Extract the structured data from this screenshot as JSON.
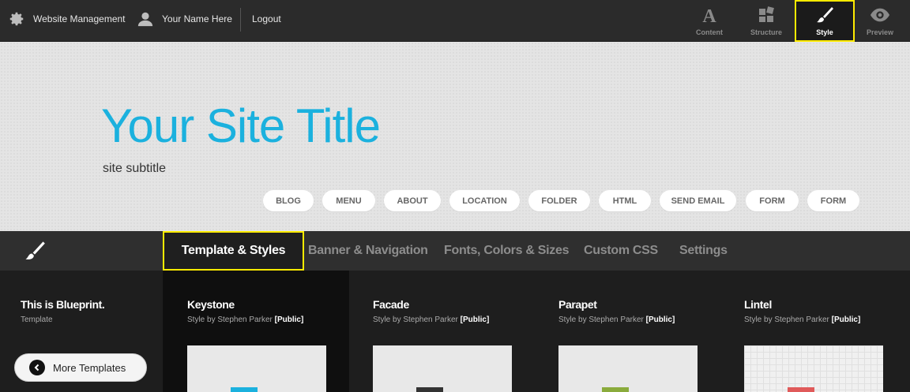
{
  "topbar": {
    "website_management": "Website Management",
    "user_name": "Your Name Here",
    "logout": "Logout",
    "tools": [
      {
        "label": "Content",
        "icon": "text-a-icon"
      },
      {
        "label": "Structure",
        "icon": "blocks-icon"
      },
      {
        "label": "Style",
        "icon": "brush-icon",
        "active": true
      },
      {
        "label": "Preview",
        "icon": "eye-icon"
      }
    ]
  },
  "banner": {
    "site_title": "Your Site Title",
    "site_subtitle": "site subtitle",
    "nav_items": [
      "BLOG",
      "MENU",
      "ABOUT",
      "LOCATION",
      "FOLDER",
      "HTML",
      "SEND EMAIL",
      "FORM",
      "FORM"
    ]
  },
  "tabs": [
    {
      "label": "Template & Styles",
      "active": true
    },
    {
      "label": "Banner & Navigation"
    },
    {
      "label": "Fonts, Colors & Sizes"
    },
    {
      "label": "Custom CSS"
    },
    {
      "label": "Settings"
    }
  ],
  "template": {
    "name": "This is Blueprint.",
    "type": "Template",
    "more_button": "More Templates"
  },
  "styles": [
    {
      "name": "Keystone",
      "by": "Style by Stephen Parker",
      "tag": "[Public]",
      "swatch": "#1bb1de"
    },
    {
      "name": "Facade",
      "by": "Style by Stephen Parker",
      "tag": "[Public]",
      "swatch": "#333333"
    },
    {
      "name": "Parapet",
      "by": "Style by Stephen Parker",
      "tag": "[Public]",
      "swatch": "#8aab3c"
    },
    {
      "name": "Lintel",
      "by": "Style by Stephen Parker",
      "tag": "[Public]",
      "swatch": "#e05a5a"
    }
  ],
  "colors": {
    "accent": "#1bb1de",
    "highlight": "#ffeb00"
  }
}
